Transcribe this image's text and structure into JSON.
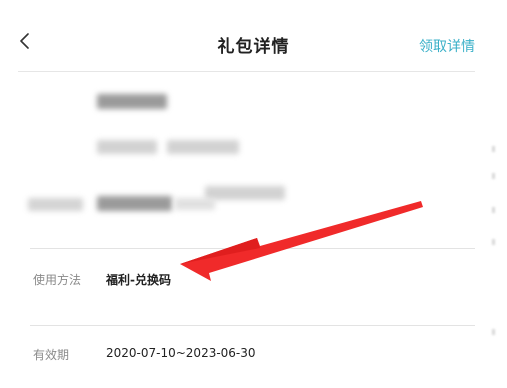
{
  "header": {
    "title": "礼包详情",
    "action_label": "领取详情"
  },
  "details": [
    {
      "label": "使用方法",
      "value": "福利-兑换码"
    },
    {
      "label": "有效期",
      "value": "2020-07-10~2023-06-30"
    }
  ],
  "colors": {
    "accent": "#3ab0c8",
    "annotation_arrow": "#f02a2a"
  },
  "icons": {
    "back": "chevron-left-icon"
  }
}
